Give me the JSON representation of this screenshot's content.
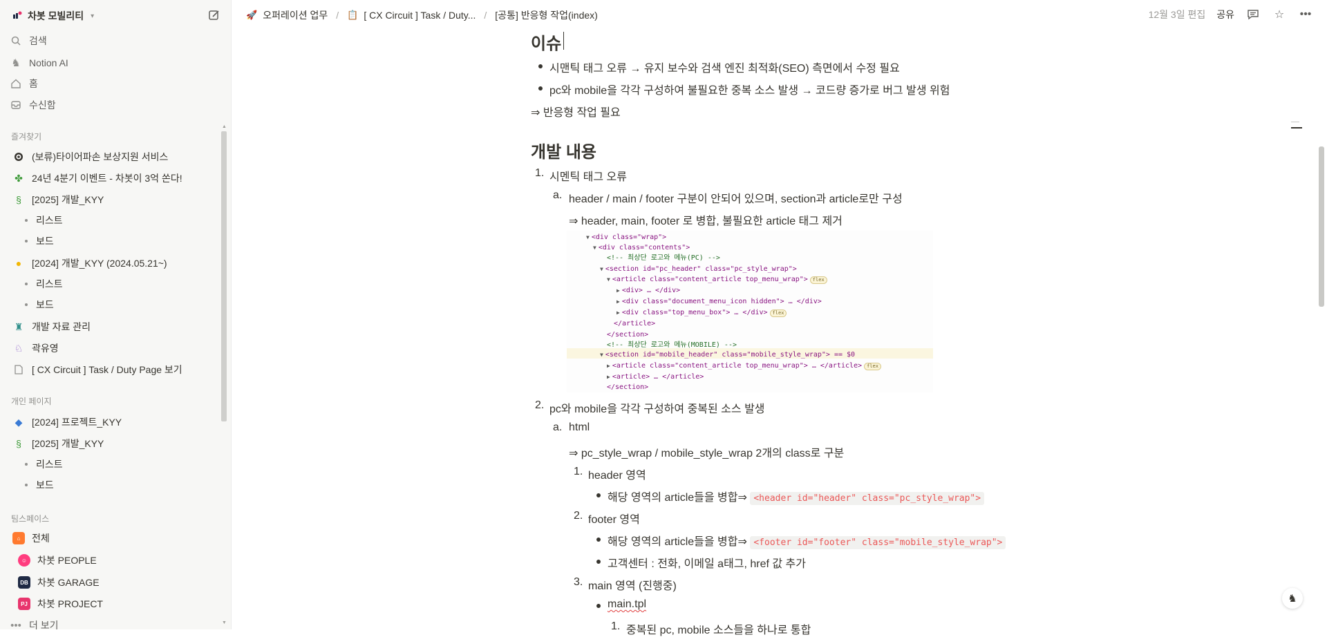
{
  "sidebar": {
    "workspace_name": "차봇 모빌리티",
    "nav": [
      {
        "label": "검색",
        "icon": "search-icon"
      },
      {
        "label": "Notion AI",
        "icon": "notion-ai-icon"
      },
      {
        "label": "홈",
        "icon": "home-icon"
      },
      {
        "label": "수신함",
        "icon": "inbox-icon"
      }
    ],
    "favorites_label": "즐겨찾기",
    "favorites": [
      {
        "label": "(보류)타이어파손 보상지원 서비스",
        "icon": "target-icon"
      },
      {
        "label": "24년 4분기 이벤트 - 차봇이 3억 쏜다!",
        "icon": "clover-icon"
      },
      {
        "label": "[2025] 개발_KYY",
        "icon": "snake-icon"
      },
      {
        "label": "리스트",
        "icon": "dot"
      },
      {
        "label": "보드",
        "icon": "dot"
      },
      {
        "label": "[2024] 개발_KYY (2024.05.21~)",
        "icon": "chick-icon"
      },
      {
        "label": "리스트",
        "icon": "dot"
      },
      {
        "label": "보드",
        "icon": "dot"
      },
      {
        "label": "개발 자료 관리",
        "icon": "statue-icon"
      },
      {
        "label": "곽유영",
        "icon": "unicorn-icon"
      },
      {
        "label": "[ CX Circuit ] Task / Duty Page 보기",
        "icon": "page-icon"
      }
    ],
    "personal_label": "개인 페이지",
    "personal": [
      {
        "label": "[2024] 프로젝트_KYY",
        "icon": "bird-icon"
      },
      {
        "label": "[2025] 개발_KYY",
        "icon": "snake-icon"
      },
      {
        "label": "리스트",
        "icon": "dot"
      },
      {
        "label": "보드",
        "icon": "dot"
      }
    ],
    "teamspace_label": "팀스페이스",
    "teamspaces": [
      {
        "label": "전체",
        "badge": "",
        "color": "#ff7a2f"
      },
      {
        "label": "차봇 PEOPLE",
        "badge": "",
        "color": "#ff3d7f"
      },
      {
        "label": "차봇 GARAGE",
        "badge": "DB",
        "color": "#1f2a44"
      },
      {
        "label": "차봇 PROJECT",
        "badge": "PJ",
        "color": "#e8356d"
      }
    ],
    "more_label": "더 보기"
  },
  "topbar": {
    "breadcrumbs": [
      {
        "label": "오퍼레이션 업무",
        "icon": "rocket-icon"
      },
      {
        "label": "[ CX Circuit ] Task / Duty...",
        "icon": "clipboard-icon"
      },
      {
        "label": "[공통] 반응형 작업(index)",
        "icon": ""
      }
    ],
    "edited": "12월 3일 편집",
    "share": "공유"
  },
  "doc": {
    "issue_heading": "이슈",
    "issue_bullets": [
      "시맨틱 태그 오류 → 유지 보수와 검색 엔진 최적화(SEO) 측면에서 수정 필요",
      " pc와 mobile을 각각 구성하여 불필요한 중복 소스 발생 → 코드량 증가로 버그 발생 위험"
    ],
    "issue_conclusion": "⇒  반응형 작업 필요",
    "dev_heading": "개발 내용",
    "item1": "시멘틱 태그 오류",
    "item1_a": "header / main / footer 구분이 안되어 있으며, section과 article로만 구성",
    "item1_a_result": "⇒ header, main, footer 로 병합, 불필요한 article 태그 제거",
    "item2": "pc와 mobile을 각각 구성하여 중복된 소스 발생",
    "item2_a": "html",
    "item2_a_result": "⇒ pc_style_wrap / mobile_style_wrap 2개의 class로 구분",
    "sub1": "header 영역",
    "sub1_bullet": "해당 영역의 article들을 병합⇒ ",
    "sub1_code": "<header id=\"header\" class=\"pc_style_wrap\">",
    "sub2": "footer 영역",
    "sub2_bullet": "해당 영역의 article들을 병합⇒ ",
    "sub2_code": "<footer id=\"footer\" class=\"mobile_style_wrap\">",
    "sub2_bullet2": "고객센터 : 전화, 이메일 a태그, href 값 추가",
    "sub3": "main 영역 (진행중)",
    "sub3_bullet": "main.tpl",
    "sub3_sub": "중복된 pc, mobile 소스들을 하나로 통합"
  },
  "devtools": {
    "lines": [
      "<div class=\"wrap\">",
      "<div class=\"contents\">",
      "<!-- 최상단 로고와 메뉴(PC) -->",
      "<section id=\"pc_header\" class=\"pc_style_wrap\">",
      "<article class=\"content_article top_menu_wrap\">",
      "<div> … </div>",
      "<div class=\"document_menu_icon hidden\"> … </div>",
      "<div class=\"top_menu_box\"> … </div>",
      "</article>",
      "</section>",
      "<!-- 최상단 로고와 메뉴(MOBILE) -->",
      "<section id=\"mobile_header\" class=\"mobile_style_wrap\"> == $0",
      "<article class=\"content_article top_menu_wrap\"> … </article>",
      "<article> … </article>",
      "</section>"
    ],
    "flex_badge": "flex"
  }
}
